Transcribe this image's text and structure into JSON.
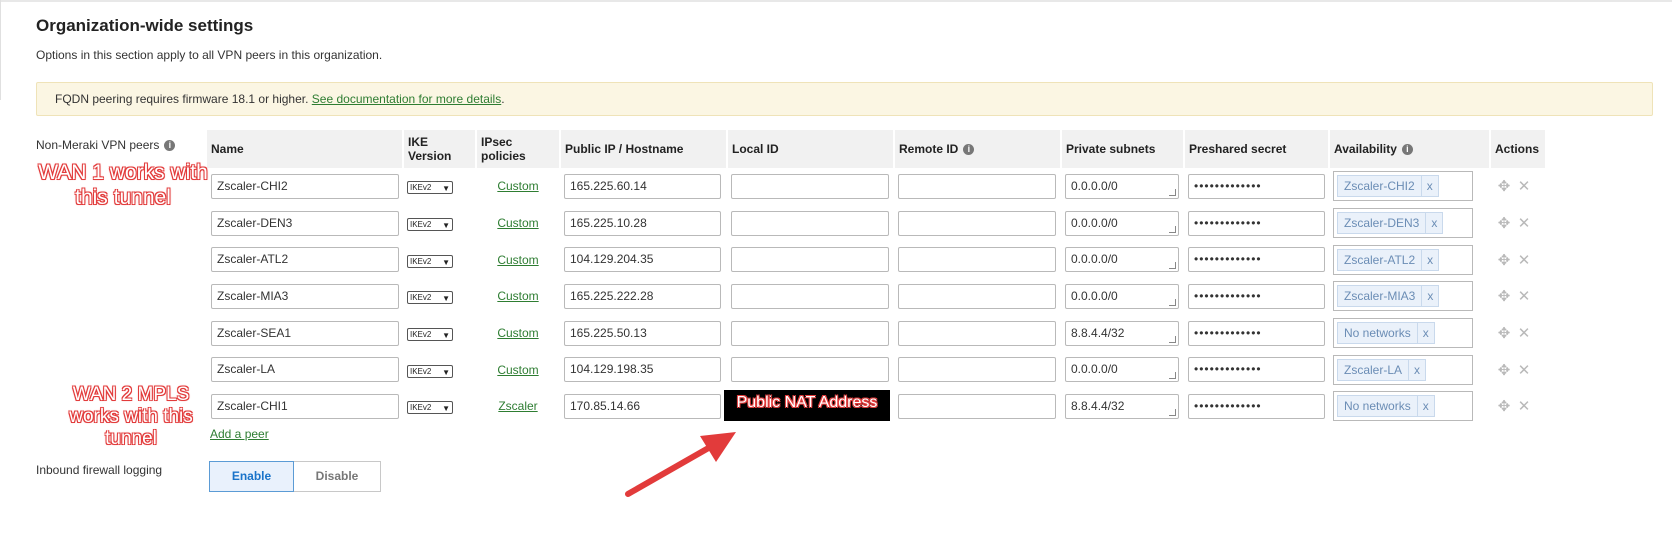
{
  "section": {
    "title": "Organization-wide settings",
    "description": "Options in this section apply to all VPN peers in this organization."
  },
  "banner": {
    "text": "FQDN peering requires firmware 18.1 or higher. ",
    "link": "See documentation for more details",
    "suffix": "."
  },
  "peers": {
    "label": "Non-Meraki VPN peers",
    "columns": {
      "name": "Name",
      "ike": "IKE Version",
      "ipsec": "IPsec policies",
      "ip": "Public IP / Hostname",
      "local_id": "Local ID",
      "remote_id": "Remote ID",
      "subnets": "Private subnets",
      "secret": "Preshared secret",
      "availability": "Availability",
      "actions": "Actions"
    },
    "rows": [
      {
        "name": "Zscaler-CHI2",
        "ike": "IKEv2",
        "policy": "Custom",
        "ip": "165.225.60.14",
        "local_id": "",
        "remote_id": "",
        "subnets": "0.0.0.0/0",
        "secret": "•••••••••••••",
        "tag": "Zscaler-CHI2"
      },
      {
        "name": "Zscaler-DEN3",
        "ike": "IKEv2",
        "policy": "Custom",
        "ip": "165.225.10.28",
        "local_id": "",
        "remote_id": "",
        "subnets": "0.0.0.0/0",
        "secret": "•••••••••••••",
        "tag": "Zscaler-DEN3"
      },
      {
        "name": "Zscaler-ATL2",
        "ike": "IKEv2",
        "policy": "Custom",
        "ip": "104.129.204.35",
        "local_id": "",
        "remote_id": "",
        "subnets": "0.0.0.0/0",
        "secret": "•••••••••••••",
        "tag": "Zscaler-ATL2"
      },
      {
        "name": "Zscaler-MIA3",
        "ike": "IKEv2",
        "policy": "Custom",
        "ip": "165.225.222.28",
        "local_id": "",
        "remote_id": "",
        "subnets": "0.0.0.0/0",
        "secret": "•••••••••••••",
        "tag": "Zscaler-MIA3"
      },
      {
        "name": "Zscaler-SEA1",
        "ike": "IKEv2",
        "policy": "Custom",
        "ip": "165.225.50.13",
        "local_id": "",
        "remote_id": "",
        "subnets": "8.8.4.4/32",
        "secret": "•••••••••••••",
        "tag": "No networks"
      },
      {
        "name": "Zscaler-LA",
        "ike": "IKEv2",
        "policy": "Custom",
        "ip": "104.129.198.35",
        "local_id": "",
        "remote_id": "",
        "subnets": "0.0.0.0/0",
        "secret": "•••••••••••••",
        "tag": "Zscaler-LA"
      },
      {
        "name": "Zscaler-CHI1",
        "ike": "IKEv2",
        "policy": "Zscaler",
        "ip": "170.85.14.66",
        "local_id": "",
        "remote_id": "",
        "subnets": "8.8.4.4/32",
        "secret": "•••••••••••••",
        "tag": "No networks"
      }
    ],
    "tag_remove": "x",
    "add_peer": "Add a peer"
  },
  "annotations": {
    "wan1": "WAN 1 works with this tunnel",
    "wan2": "WAN 2 MPLS works with this tunnel",
    "nat": "Public NAT Address"
  },
  "firewall": {
    "label": "Inbound firewall logging",
    "enable": "Enable",
    "disable": "Disable",
    "selected": "Enable"
  },
  "icons": {
    "info": "info-icon",
    "move": "move-icon",
    "delete": "close-icon",
    "select_caret": "chevron-down-icon"
  },
  "colors": {
    "link": "#2e7d32",
    "annotation": "#e23b3b",
    "banner_bg": "#fbf6e3",
    "tag_bg": "#eaf1fa",
    "toggle_active": "#1a73c9"
  }
}
